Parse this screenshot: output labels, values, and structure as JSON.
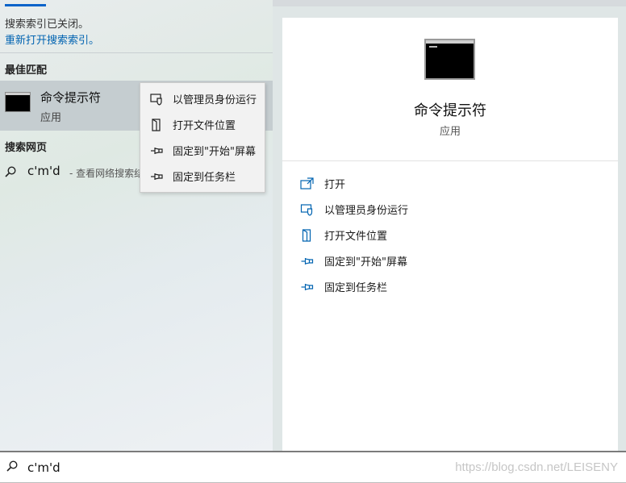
{
  "left": {
    "notice": "搜索索引已关闭。",
    "reopen_link": "重新打开搜索索引。",
    "best_match_label": "最佳匹配",
    "best_match": {
      "title": "命令提示符",
      "subtitle": "应用",
      "icon": "cmd-icon"
    },
    "web_label": "搜索网页",
    "web_result": {
      "query": "c'm'd",
      "suffix": "- 查看网络搜索结果",
      "icon": "search-icon"
    }
  },
  "context_menu": [
    {
      "label": "以管理员身份运行",
      "icon": "admin-shield-icon"
    },
    {
      "label": "打开文件位置",
      "icon": "file-location-icon"
    },
    {
      "label": "固定到\"开始\"屏幕",
      "icon": "pin-icon"
    },
    {
      "label": "固定到任务栏",
      "icon": "pin-icon"
    }
  ],
  "detail": {
    "title": "命令提示符",
    "subtitle": "应用",
    "actions": [
      {
        "label": "打开",
        "icon": "open-icon"
      },
      {
        "label": "以管理员身份运行",
        "icon": "admin-shield-icon"
      },
      {
        "label": "打开文件位置",
        "icon": "file-location-icon"
      },
      {
        "label": "固定到\"开始\"屏幕",
        "icon": "pin-icon"
      },
      {
        "label": "固定到任务栏",
        "icon": "pin-icon"
      }
    ]
  },
  "search": {
    "value": "c'm'd",
    "icon": "search-icon"
  },
  "watermark": "https://blog.csdn.net/LEISENY",
  "colors": {
    "accent": "#0a63c9",
    "link": "#0063b1",
    "icon": "#0063b1"
  }
}
